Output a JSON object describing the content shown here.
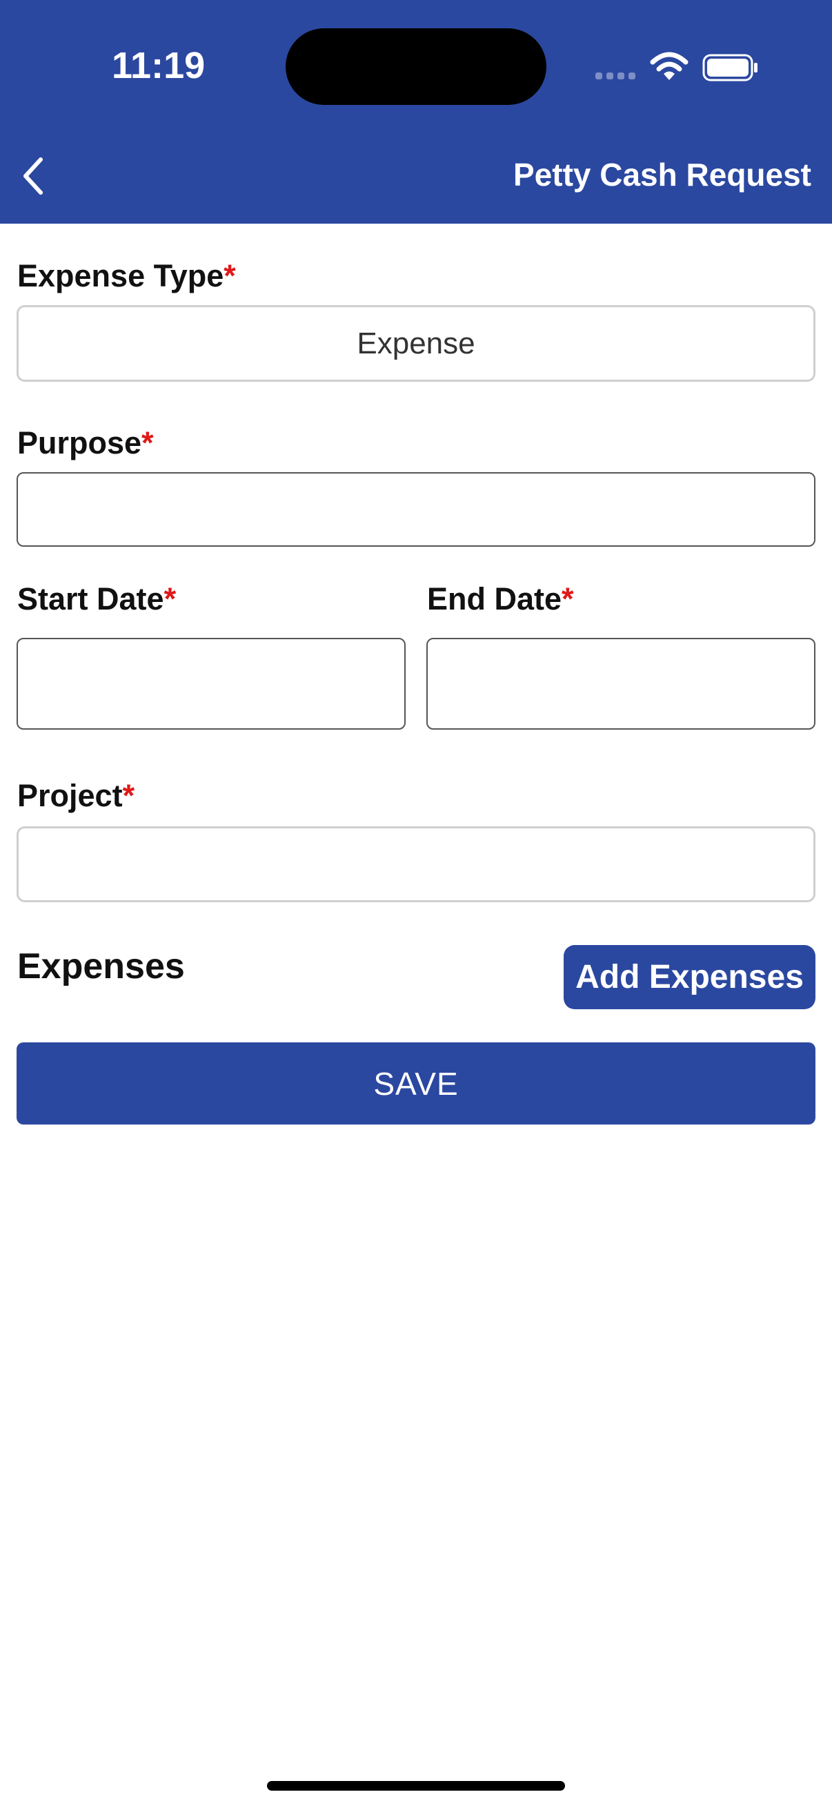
{
  "status_bar": {
    "time": "11:19"
  },
  "nav": {
    "title": "Petty Cash Request",
    "back_icon": "chevron-left-icon"
  },
  "form": {
    "expense_type": {
      "label": "Expense Type",
      "required_mark": "*",
      "value": "Expense"
    },
    "purpose": {
      "label": "Purpose",
      "required_mark": "*",
      "value": ""
    },
    "start_date": {
      "label": "Start Date",
      "required_mark": "*",
      "value": ""
    },
    "end_date": {
      "label": "End Date",
      "required_mark": "*",
      "value": ""
    },
    "project": {
      "label": "Project",
      "required_mark": "*",
      "value": ""
    }
  },
  "expenses": {
    "heading": "Expenses",
    "add_label": "Add Expenses"
  },
  "actions": {
    "save_label": "SAVE"
  },
  "colors": {
    "primary": "#2b48a0",
    "required": "#e01818",
    "background": "#ffffff"
  }
}
